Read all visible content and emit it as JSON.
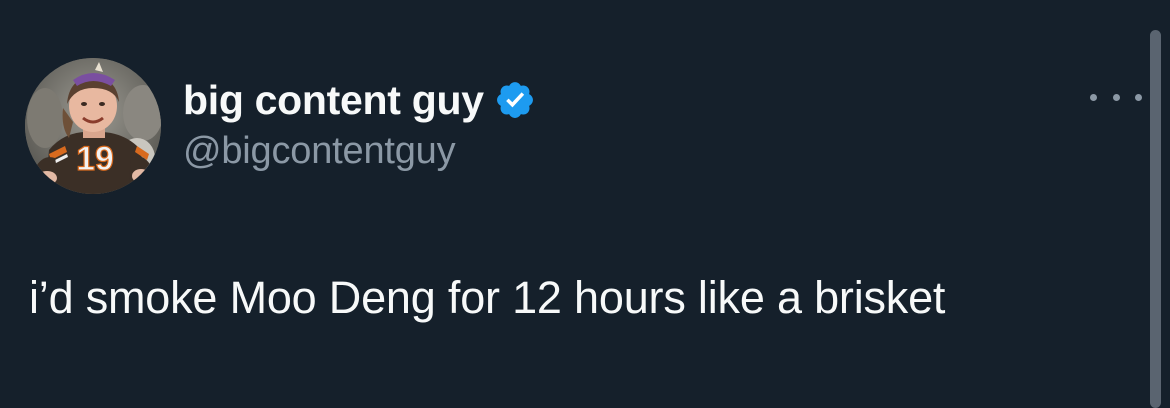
{
  "tweet": {
    "author": {
      "display_name": "big content guy",
      "handle": "@bigcontentguy",
      "verified": true,
      "verified_icon": "verified-badge-icon",
      "avatar_icon": "avatar-photo"
    },
    "more_icon": "more-options-icon",
    "text": "i’d smoke Moo Deng for 12 hours like a brisket",
    "avatar_jersey_number": "19"
  },
  "colors": {
    "background": "#15202b",
    "primary_text": "#f7f9f9",
    "secondary_text": "#8b98a5",
    "verified_blue": "#1d9bf0",
    "scrollbar": "#5a6470"
  }
}
